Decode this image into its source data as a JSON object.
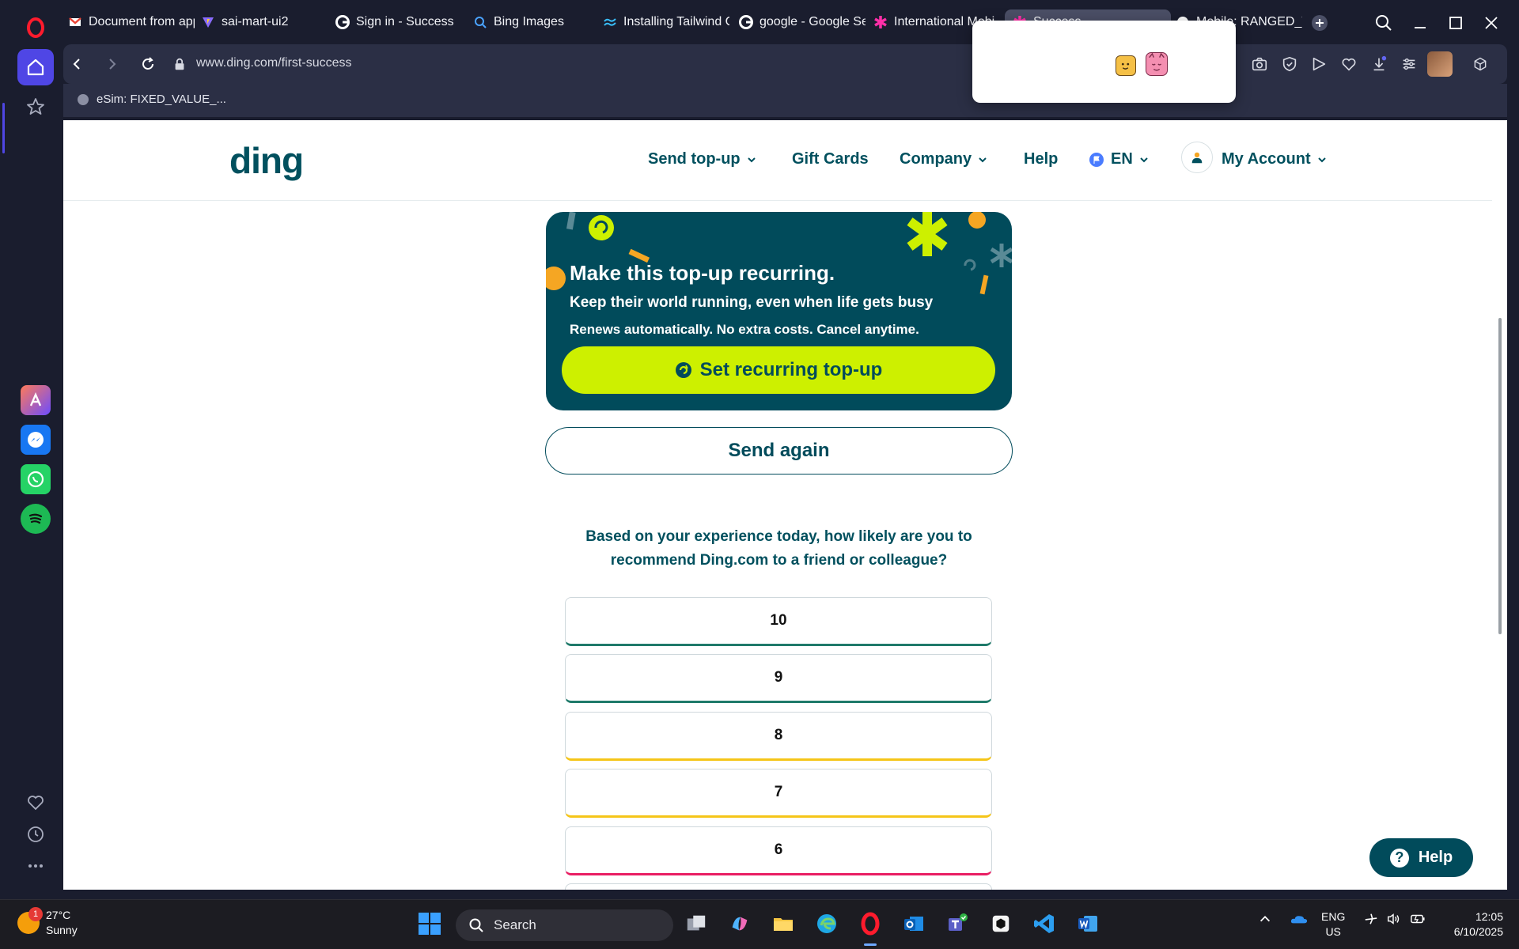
{
  "browser": {
    "tabs": [
      {
        "label": "Document from app",
        "favicon": "gmail-icon"
      },
      {
        "label": "sai-mart-ui2",
        "favicon": "vite-icon"
      },
      {
        "label": "Sign in - Success",
        "favicon": "google-icon"
      },
      {
        "label": "Bing Images",
        "favicon": "bing-search-icon"
      },
      {
        "label": "Installing Tailwind C",
        "favicon": "tailwind-icon"
      },
      {
        "label": "google - Google Sea",
        "favicon": "google-icon"
      },
      {
        "label": "International Mobi",
        "favicon": "ding-asterisk-icon"
      },
      {
        "label": "Success",
        "favicon": "ding-asterisk-icon"
      },
      {
        "label": "Mobile: RANGED_V",
        "favicon": "dot-icon"
      }
    ],
    "url": "www.ding.com/first-success",
    "bookmark": "eSim: FIXED_VALUE_..."
  },
  "site": {
    "logo": "ding",
    "nav": {
      "send_topup": "Send top-up",
      "gift_cards": "Gift Cards",
      "company": "Company",
      "help": "Help",
      "language": "EN",
      "account": "My Account"
    },
    "recurring": {
      "title": "Make this top-up recurring.",
      "subtitle": "Keep their world running, even when life gets busy",
      "note": "Renews automatically. No extra costs. Cancel anytime.",
      "button": "Set recurring top-up"
    },
    "send_again": "Send again",
    "survey": {
      "question": "Based on your experience today, how likely are you to recommend Ding.com to a friend or colleague?",
      "scores": [
        {
          "label": "10",
          "color": "#1f7a6a"
        },
        {
          "label": "9",
          "color": "#1f7a6a"
        },
        {
          "label": "8",
          "color": "#f5c518"
        },
        {
          "label": "7",
          "color": "#f5c518"
        },
        {
          "label": "6",
          "color": "#e91e63"
        }
      ]
    },
    "help_button": "Help"
  },
  "taskbar": {
    "weather_temp": "27°C",
    "weather_desc": "Sunny",
    "weather_badge": "1",
    "search": "Search",
    "lang_top": "ENG",
    "lang_bottom": "US",
    "time": "12:05",
    "date": "6/10/2025"
  },
  "colors": {
    "brand_teal": "#014b5b",
    "lime": "#cdf000",
    "opera_red": "#ff1b2d",
    "sidebar_accent": "#4f46e5"
  }
}
